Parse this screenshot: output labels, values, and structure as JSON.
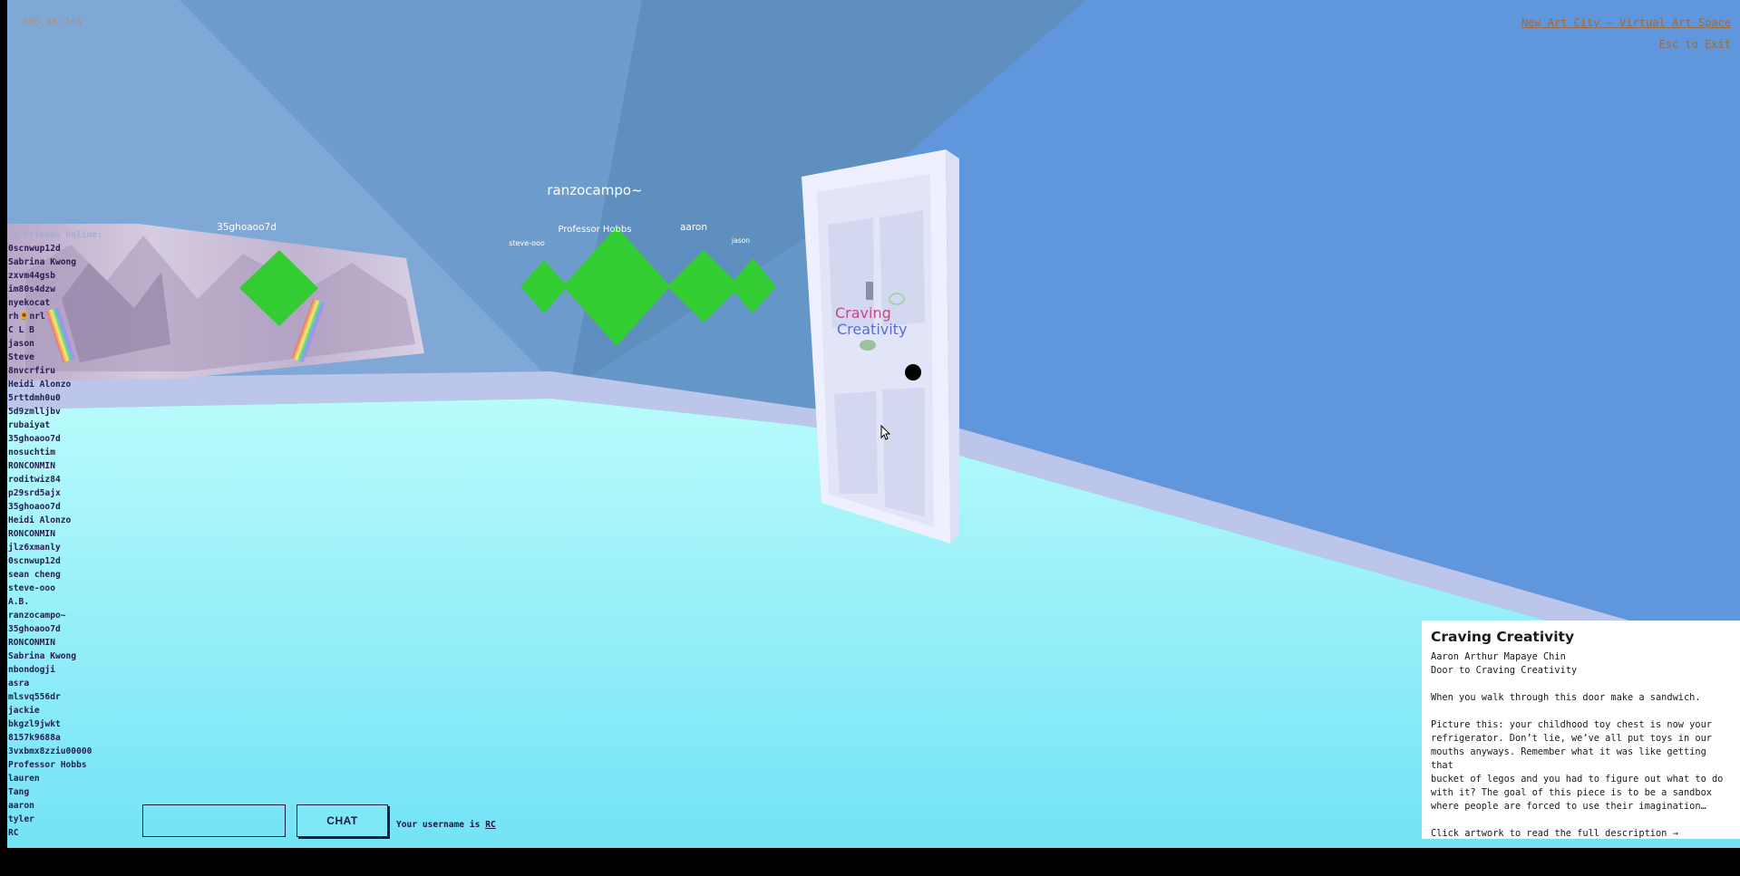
{
  "hud": {
    "coords": "306,88,748",
    "title_link": "New Art City – Virtual Art Space",
    "esc_hint": "Esc to Exit"
  },
  "friends": {
    "header": "44 Friends Online:",
    "names": [
      "0scnwup12d",
      "Sabrina Kwong",
      "zxvm44gsb",
      "im80s4dzw",
      "nyekocat",
      "rh🌻nrl",
      "C L B",
      "jason",
      "Steve",
      "8nvcrfiru",
      "Heidi Alonzo",
      "5rttdmh0u0",
      "5d9zmlljbv",
      "rubaiyat",
      "35ghoaoo7d",
      "nosuchtim",
      "RONCONMIN",
      "roditwiz84",
      "p29srd5ajx",
      "35ghoaoo7d",
      "Heidi Alonzo",
      "RONCONMIN",
      "jlz6xmanly",
      "0scnwup12d",
      "sean cheng",
      "steve-ooo",
      "A.B.",
      "ranzocampo~",
      "35ghoaoo7d",
      "RONCONMIN",
      "Sabrina Kwong",
      "nbondogji",
      "asra",
      "mlsvq556dr",
      "jackie",
      "bkgzl9jwkt",
      "8157k9688a",
      "3vxbmx8zziu00000",
      "Professor Hobbs",
      "lauren",
      "Tang",
      "aaron",
      "tyler",
      "RC"
    ]
  },
  "avatars": {
    "ranzocampo": "ranzocampo~",
    "g35": "35ghoaoo7d",
    "steve": "steve-ooo",
    "hobbs": "Professor Hobbs",
    "aaron": "aaron",
    "jason": "jason"
  },
  "artwork": {
    "door_line1": "Craving",
    "door_line2": "Creativity"
  },
  "chat": {
    "input_value": "",
    "button_label": "CHAT",
    "username_prefix": "Your username is",
    "username": "RC"
  },
  "info_panel": {
    "title": "Craving Creativity",
    "artist": "Aaron Arthur Mapaye Chin",
    "subtitle": "Door to Craving Creativity",
    "line1": "When you walk through this door make a sandwich.",
    "paragraph_lines": [
      "Picture this: your childhood toy chest is now your",
      "refrigerator. Don’t lie, we’ve all put toys in our",
      "mouths anyways. Remember what it was like getting that",
      "bucket of legos and you had to figure out what to do",
      "with it? The goal of this piece is to be a sandbox",
      "where people are forced to use their imagination…"
    ],
    "cta": "Click artwork to read the full description →"
  },
  "colors": {
    "floor": "#8ff0fb",
    "wall_left": "#6a98c8",
    "wall_right": "#5d93dc",
    "avatar_green": "#33cc33",
    "door": "#eef0ff"
  }
}
